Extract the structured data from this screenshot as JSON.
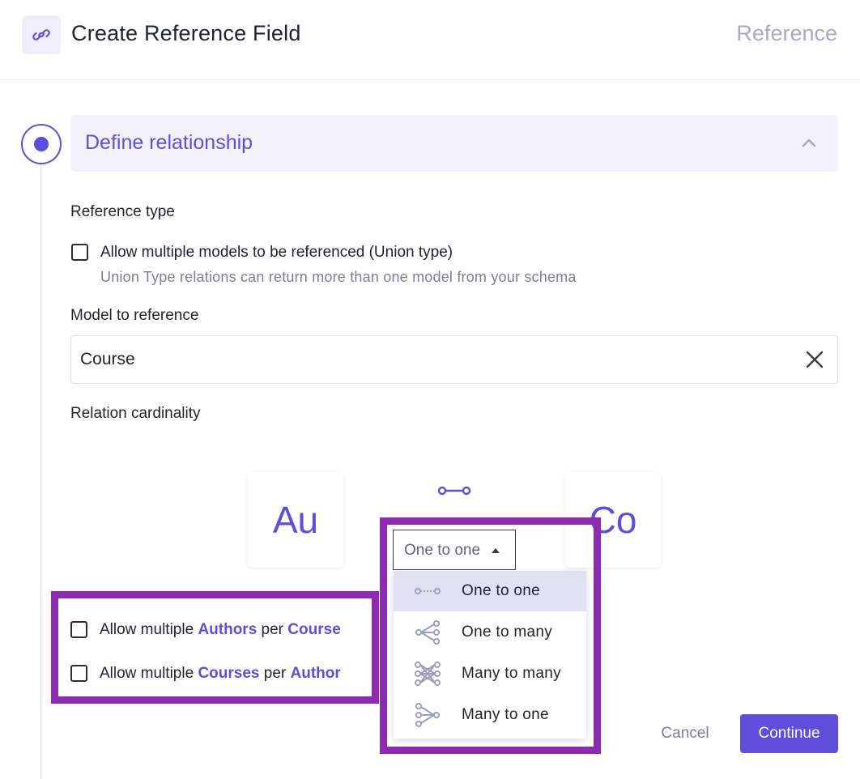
{
  "header": {
    "title": "Create Reference Field",
    "badge": "Reference",
    "icon": "link-icon"
  },
  "section": {
    "title": "Define relationship",
    "expanded": true
  },
  "reference_type": {
    "label": "Reference type",
    "union_checkbox_label": "Allow multiple models to be referenced (Union type)",
    "union_checked": false,
    "union_help": "Union Type relations can return more than one model from your schema"
  },
  "model_reference": {
    "label": "Model to reference",
    "value": "Course"
  },
  "cardinality": {
    "label": "Relation cardinality",
    "left_card": "Au",
    "right_card": "Co",
    "selected": "One to one",
    "options": [
      {
        "label": "One to one",
        "icon": "one-to-one-icon",
        "selected": true
      },
      {
        "label": "One to many",
        "icon": "one-to-many-icon",
        "selected": false
      },
      {
        "label": "Many to many",
        "icon": "many-to-many-icon",
        "selected": false
      },
      {
        "label": "Many to one",
        "icon": "many-to-one-icon",
        "selected": false
      }
    ]
  },
  "permissions": {
    "row1": {
      "prefix": "Allow multiple ",
      "entity": "Authors",
      "mid": " per ",
      "target": "Course",
      "checked": false
    },
    "row2": {
      "prefix": "Allow multiple ",
      "entity": "Courses",
      "mid": " per ",
      "target": "Author",
      "checked": false
    }
  },
  "footer": {
    "cancel": "Cancel",
    "continue": "Continue"
  },
  "colors": {
    "accent": "#5d4fd9",
    "highlight": "#8e2ab2",
    "muted": "#a7a9c6"
  }
}
